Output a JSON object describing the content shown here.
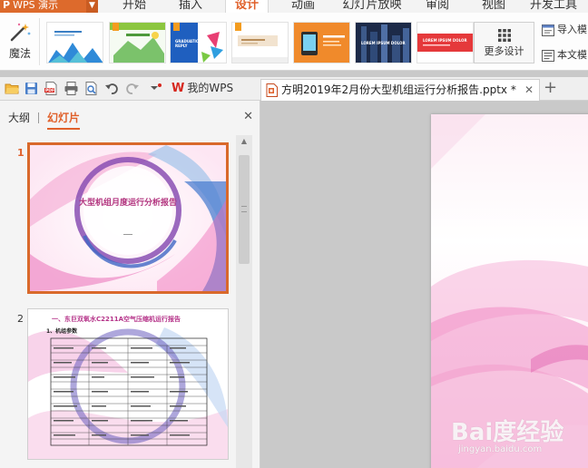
{
  "app": {
    "name": "WPS 演示",
    "logo_letter": "P"
  },
  "menu": {
    "tabs": [
      "开始",
      "插入",
      "设计",
      "动画",
      "幻灯片放映",
      "审阅",
      "视图",
      "开发工具"
    ],
    "active": "设计"
  },
  "ribbon": {
    "magic_label": "魔法",
    "theme_captions": [
      "",
      "",
      "GRADUATION REPLY",
      "",
      "",
      "LOREM IPSUM DOLOR",
      "LOREM IPSUM DOLOR"
    ],
    "more_design_label": "更多设计",
    "import_label": "导入模",
    "text_label": "本文模"
  },
  "toolbar": {
    "home_tab_label": "我的WPS",
    "doc_tab_label": "方明2019年2月份大型机组运行分析报告.pptx *",
    "close_symbol": "✕",
    "new_tab_symbol": "+"
  },
  "left_panel": {
    "tab_outline": "大纲",
    "tab_slides": "幻灯片",
    "close_symbol": "✕",
    "slides": [
      {
        "number": "1",
        "title": "大型机组月度运行分析报告"
      },
      {
        "number": "2",
        "title": "一、东巨双氧水C2211A空气压缩机运行报告",
        "subtitle": "1、机组参数"
      }
    ]
  },
  "watermark": {
    "main": "Bai度经验",
    "sub": "jingyan.baidu.com"
  },
  "colors": {
    "accent": "#e0602a",
    "app_button": "#dd6a2c",
    "slide_pink": "#f06bb5",
    "slide_purple": "#7a3fa8",
    "slide_blue": "#2f6fc2"
  }
}
